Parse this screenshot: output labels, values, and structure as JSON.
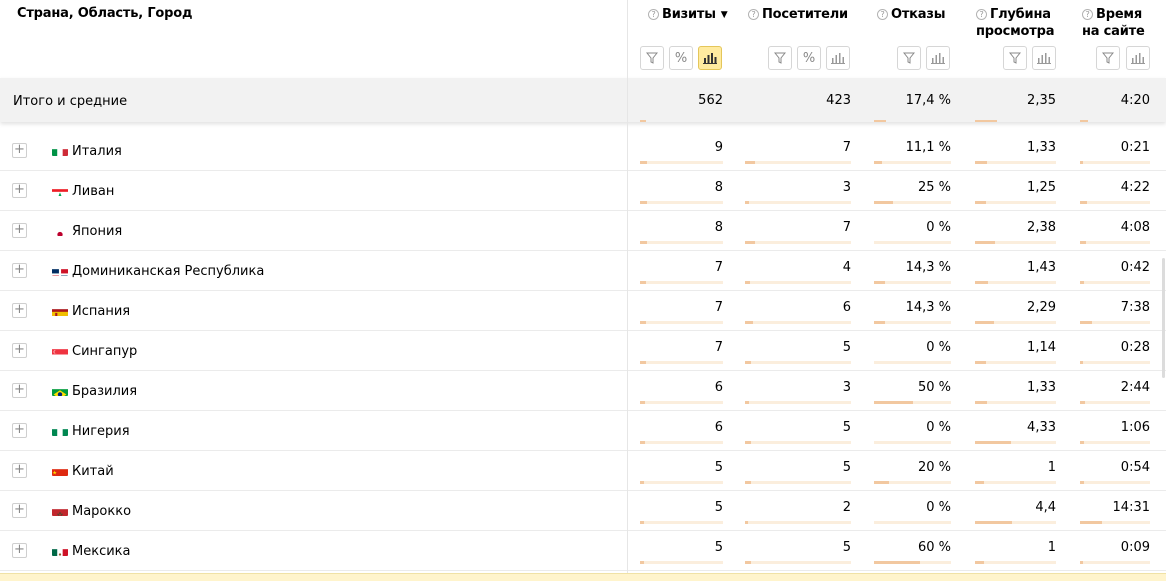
{
  "header": {
    "dimension_title": "Страна, Область, Город",
    "columns": [
      {
        "label_line1": "Визиты",
        "label_line2": "",
        "sorted": true,
        "sort_arrow": "▼"
      },
      {
        "label_line1": "Посетители",
        "label_line2": ""
      },
      {
        "label_line1": "Отказы",
        "label_line2": ""
      },
      {
        "label_line1": "Глубина",
        "label_line2": "просмотра"
      },
      {
        "label_line1": "Время",
        "label_line2": "на сайте"
      }
    ],
    "qmark": "?",
    "button_icons": [
      "filter-icon",
      "percent-icon",
      "bar-chart-icon"
    ],
    "percent_symbol": "%"
  },
  "totals": {
    "label": "Итого и средние",
    "values": [
      "562",
      "423",
      "17,4 %",
      "2,35",
      "4:20"
    ]
  },
  "rows": [
    {
      "country": "Италия",
      "flag": "italy",
      "values": [
        "9",
        "7",
        "11,1 %",
        "1,33",
        "0:21"
      ],
      "bars": [
        0.09,
        0.09,
        0.11,
        0.15,
        0.04
      ]
    },
    {
      "country": "Ливан",
      "flag": "lebanon",
      "values": [
        "8",
        "3",
        "25 %",
        "1,25",
        "4:22"
      ],
      "bars": [
        0.08,
        0.04,
        0.25,
        0.14,
        0.1
      ]
    },
    {
      "country": "Япония",
      "flag": "japan",
      "values": [
        "8",
        "7",
        "0 %",
        "2,38",
        "4:08"
      ],
      "bars": [
        0.08,
        0.09,
        0,
        0.25,
        0.09
      ]
    },
    {
      "country": "Доминиканская Республика",
      "flag": "dominican",
      "values": [
        "7",
        "4",
        "14,3 %",
        "1,43",
        "0:42"
      ],
      "bars": [
        0.07,
        0.05,
        0.14,
        0.16,
        0.05
      ]
    },
    {
      "country": "Испания",
      "flag": "spain",
      "values": [
        "7",
        "6",
        "14,3 %",
        "2,29",
        "7:38"
      ],
      "bars": [
        0.07,
        0.08,
        0.14,
        0.24,
        0.17
      ]
    },
    {
      "country": "Сингапур",
      "flag": "singapore",
      "values": [
        "7",
        "5",
        "0 %",
        "1,14",
        "0:28"
      ],
      "bars": [
        0.07,
        0.06,
        0,
        0.13,
        0.04
      ]
    },
    {
      "country": "Бразилия",
      "flag": "brazil",
      "values": [
        "6",
        "3",
        "50 %",
        "1,33",
        "2:44"
      ],
      "bars": [
        0.06,
        0.04,
        0.5,
        0.15,
        0.07
      ]
    },
    {
      "country": "Нигерия",
      "flag": "nigeria",
      "values": [
        "6",
        "5",
        "0 %",
        "4,33",
        "1:06"
      ],
      "bars": [
        0.06,
        0.06,
        0,
        0.45,
        0.05
      ]
    },
    {
      "country": "Китай",
      "flag": "china",
      "values": [
        "5",
        "5",
        "20 %",
        "1",
        "0:54"
      ],
      "bars": [
        0.05,
        0.06,
        0.2,
        0.11,
        0.05
      ]
    },
    {
      "country": "Марокко",
      "flag": "morocco",
      "values": [
        "5",
        "2",
        "0 %",
        "4,4",
        "14:31"
      ],
      "bars": [
        0.05,
        0.03,
        0,
        0.46,
        0.31
      ]
    },
    {
      "country": "Мексика",
      "flag": "mexico",
      "values": [
        "5",
        "5",
        "60 %",
        "1",
        "0:09"
      ],
      "bars": [
        0.05,
        0.06,
        0.6,
        0.11,
        0.02
      ]
    }
  ],
  "colors": {
    "active_button": "#ffeba0",
    "bar_fill": "#f2c8a0",
    "bar_track": "#fbeedd",
    "totals_bg": "#f2f2f2"
  }
}
